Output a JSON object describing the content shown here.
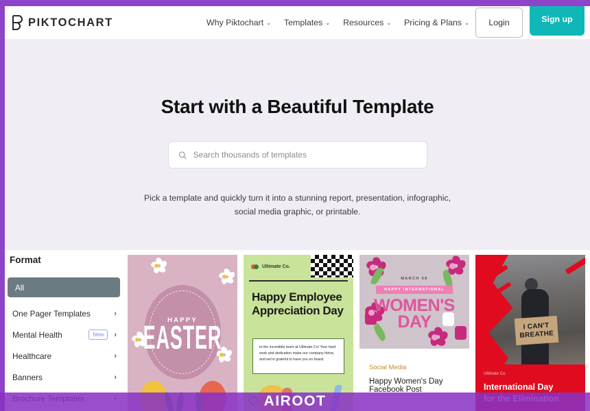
{
  "brand": {
    "logo_text": "PIKTOCHART",
    "logo_icon": "piktochart-p-icon",
    "ghost_text": "PIKTOCHART"
  },
  "header": {
    "nav": [
      {
        "label": "Why Piktochart",
        "has_caret": true
      },
      {
        "label": "Templates",
        "has_caret": true
      },
      {
        "label": "Resources",
        "has_caret": true
      },
      {
        "label": "Pricing & Plans",
        "has_caret": true
      }
    ],
    "login_label": "Login",
    "signup_label": "Sign up",
    "caret_glyph": "⌄"
  },
  "hero": {
    "title": "Start with a Beautiful Template",
    "search_placeholder": "Search thousands of templates",
    "search_value": "",
    "search_icon": "search-icon",
    "subtitle_line1": "Pick a template and quickly turn it into a stunning report, presentation, infographic,",
    "subtitle_line2": "social media graphic, or printable."
  },
  "sidebar": {
    "title": "Format",
    "items": [
      {
        "label": "All",
        "active": true,
        "badge": "",
        "chevron": false
      },
      {
        "label": "One Pager Templates",
        "active": false,
        "badge": "",
        "chevron": true
      },
      {
        "label": "Mental Health",
        "active": false,
        "badge": "New",
        "chevron": true
      },
      {
        "label": "Healthcare",
        "active": false,
        "badge": "",
        "chevron": true
      },
      {
        "label": "Banners",
        "active": false,
        "badge": "",
        "chevron": true
      },
      {
        "label": "Brochure Templates",
        "active": false,
        "badge": "",
        "chevron": true
      }
    ],
    "chevron_glyph": "›"
  },
  "templates": [
    {
      "id": "easter",
      "greeting_small": "HAPPY",
      "greeting_large": "EASTER"
    },
    {
      "id": "employee",
      "brand": "Ultimate Co.",
      "title_line1": "Happy Employee",
      "title_line2": "Appreciation Day",
      "body": "to the incredible team at Ultimate Co! Your hard work and dedication make our company thrive, and we're grateful to have you on board."
    },
    {
      "id": "women",
      "date_label": "MARCH 08",
      "ribbon": "HAPPY INTERNATIONAL",
      "title_line1": "WOMEN'S",
      "title_line2": "DAY",
      "category": "Social Media",
      "name": "Happy Women's Day Facebook Post"
    },
    {
      "id": "intl",
      "brand": "Ultimate Co.",
      "sign_line1": "I CAN'T",
      "sign_line2": "BREATHE",
      "title_line1": "International Day",
      "title_line2": "for the Elimination"
    }
  ],
  "watermark": {
    "text": "AIROOT"
  },
  "colors": {
    "brand_purple": "#8e44c8",
    "signup_teal": "#0fb7b7",
    "hero_bg": "#f0eef4",
    "sidebar_active": "#6b7b82",
    "badge_new": "#7b8cf0"
  }
}
